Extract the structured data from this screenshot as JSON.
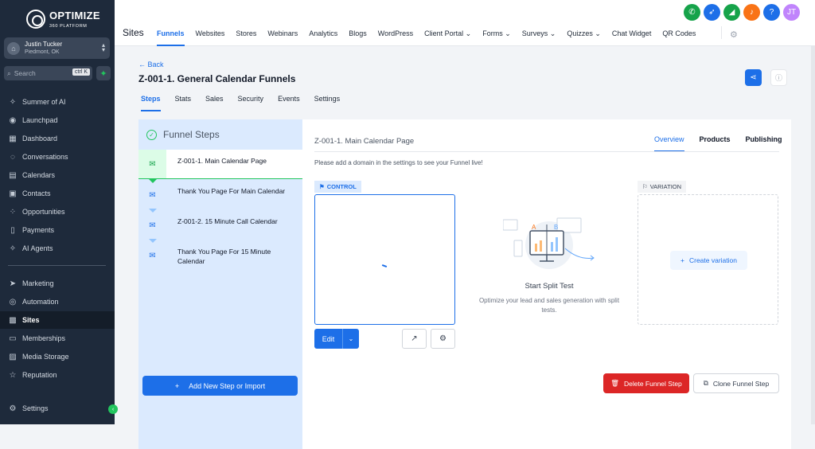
{
  "brand": {
    "name": "OPTIMIZE",
    "tagline": "360 PLATFORM"
  },
  "account": {
    "name": "Justin Tucker",
    "location": "Piedmont, OK"
  },
  "search": {
    "placeholder": "Search",
    "shortcut": "ctrl K"
  },
  "sidebar": {
    "items": [
      {
        "label": "Summer of AI",
        "icon": "sparkle-icon"
      },
      {
        "label": "Launchpad",
        "icon": "rocket-icon"
      },
      {
        "label": "Dashboard",
        "icon": "dashboard-icon"
      },
      {
        "label": "Conversations",
        "icon": "chat-icon"
      },
      {
        "label": "Calendars",
        "icon": "calendar-icon"
      },
      {
        "label": "Contacts",
        "icon": "contacts-icon"
      },
      {
        "label": "Opportunities",
        "icon": "opportunities-icon"
      },
      {
        "label": "Payments",
        "icon": "payments-icon"
      },
      {
        "label": "AI Agents",
        "icon": "ai-agents-icon"
      },
      {
        "label": "Marketing",
        "icon": "send-icon"
      },
      {
        "label": "Automation",
        "icon": "automation-icon"
      },
      {
        "label": "Sites",
        "icon": "sites-icon"
      },
      {
        "label": "Memberships",
        "icon": "memberships-icon"
      },
      {
        "label": "Media Storage",
        "icon": "media-icon"
      },
      {
        "label": "Reputation",
        "icon": "star-icon"
      },
      {
        "label": "Settings",
        "icon": "gear-icon"
      }
    ],
    "active": "Sites"
  },
  "header": {
    "section": "Sites",
    "tabs": [
      "Funnels",
      "Websites",
      "Stores",
      "Webinars",
      "Analytics",
      "Blogs",
      "WordPress",
      "Client Portal ⌄",
      "Forms ⌄",
      "Surveys ⌄",
      "Quizzes ⌄",
      "Chat Widget",
      "QR Codes"
    ],
    "active_tab": "Funnels",
    "avatar_initials": "JT",
    "icon_colors": {
      "phone": "#16a34a",
      "nav": "#1d6fe8",
      "megaphone": "#16a34a",
      "bell": "#f97316",
      "help": "#1d6fe8",
      "avatar": "#c084fc"
    }
  },
  "funnel": {
    "back": "← Back",
    "title": "Z-001-1. General Calendar Funnels",
    "tabs": [
      "Steps",
      "Stats",
      "Sales",
      "Security",
      "Events",
      "Settings"
    ],
    "active_tab": "Steps"
  },
  "steps": {
    "heading": "Funnel Steps",
    "items": [
      {
        "label": "Z-001-1. Main Calendar Page",
        "selected": true
      },
      {
        "label": "Thank You Page For Main Calendar",
        "selected": false
      },
      {
        "label": "Z-001-2. 15 Minute Call Calendar",
        "selected": false
      },
      {
        "label": "Thank You Page For 15 Minute Calendar",
        "selected": false
      }
    ],
    "add_button": "Add New Step or Import"
  },
  "detail": {
    "title": "Z-001-1. Main Calendar Page",
    "tabs": [
      "Overview",
      "Products",
      "Publishing"
    ],
    "active_tab": "Overview",
    "note": "Please add a domain in the settings to see your Funnel live!",
    "control_label": "CONTROL",
    "variation_label": "VARIATION",
    "edit_label": "Edit",
    "split_title": "Start Split Test",
    "split_sub": "Optimize your lead and sales generation with split tests.",
    "create_variation": "Create variation",
    "delete_label": "Delete Funnel Step",
    "clone_label": "Clone Funnel Step"
  }
}
